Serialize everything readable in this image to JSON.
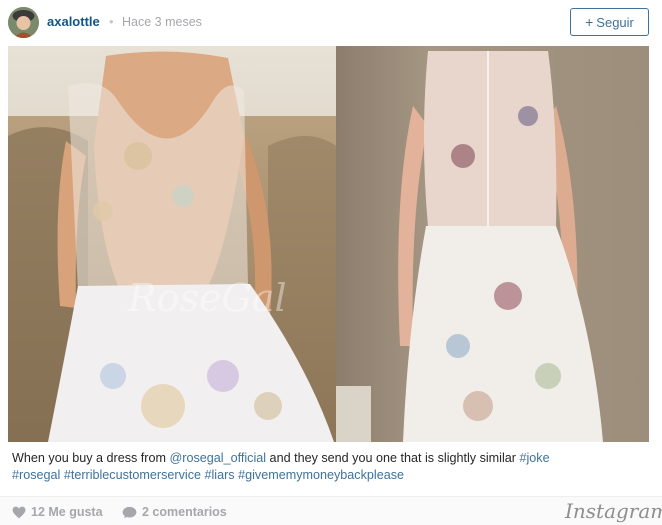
{
  "header": {
    "username": "axalottle",
    "separator": "•",
    "time": "Hace 3 meses",
    "follow_plus": "+",
    "follow_label": "Seguir"
  },
  "photo": {
    "watermark": "RoseGal"
  },
  "caption": {
    "text_1": "When you buy a dress from ",
    "mention": "@rosegal_official",
    "text_2": " and they send you one that is slightly similar ",
    "hashtags": [
      "#joke",
      "#rosegal",
      "#terriblecustomerservice",
      "#liars",
      "#givememymoneybackplease"
    ]
  },
  "footer": {
    "likes": "12 Me gusta",
    "comments": "2 comentarios",
    "brand": "Instagram"
  },
  "colors": {
    "link": "#3f729b",
    "username": "#125688",
    "muted": "#a5a7aa"
  }
}
